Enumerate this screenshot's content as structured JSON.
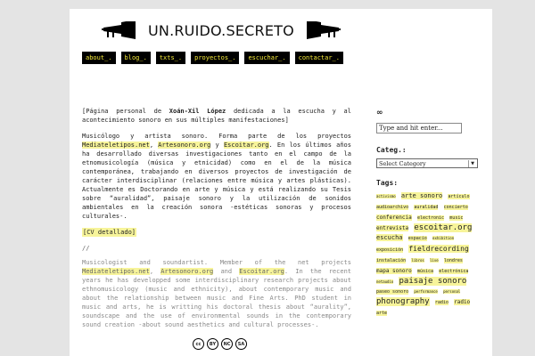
{
  "header": {
    "title": "UN.RUIDO.SECRETO"
  },
  "nav": [
    {
      "label": "about_."
    },
    {
      "label": "blog_."
    },
    {
      "label": "txts_."
    },
    {
      "label": "proyectos_."
    },
    {
      "label": "escuchar_."
    },
    {
      "label": "contactar_."
    }
  ],
  "main": {
    "intro_a": "[Página personal de ",
    "intro_name": "Xoán-Xil López",
    "intro_b": " dedicada a la escucha y al acontecimiento sonoro en sus múltiples manifestaciones]",
    "es_a": "Musicólogo y artista sonoro. Forma parte de los proyectos ",
    "link1": "Mediateletipos.net",
    "sep_comma": ", ",
    "link2": "Artesonoro.org",
    "es_y": " y ",
    "link3": "Escoitar.org",
    "es_b": ". En los últimos años ha desarrollado diversas investigaciones tanto en el campo de la etnomusicología (música y etnicidad) como en el de la música contemporánea, trabajando en diversos proyectos de investigación de carácter interdisciplinar (relaciones entre música y artes plásticas). Actualmente es Doctorando en arte y música y está realizando su Tesis sobre “auralidad”, paisaje sonoro y la utilización de sonidos ambientales en la creación sonora -estéticas sonoras y procesos culturales-.",
    "cv": "[CV detallado]",
    "divider": "//",
    "en_a": "Musicologist and soundartist. Member of the net projects ",
    "en_and": " and ",
    "en_b": ". In the recent years he has developped some interdisciplinary research projects about ethnomusicology (music and ethnicity), about contemporary music and about the relationship between music and Fine Arts. PhD student in music and arts, he is writting his doctoral thesis about “aurality”, soundscape and the use of environmental sounds in the contemporary sound creation -about sound aesthetics and cultural processes-.",
    "cc_badges": [
      "cc",
      "BY",
      "NC",
      "SA"
    ]
  },
  "sidebar": {
    "symbol": "∞",
    "search_value": "Type and hit enter...",
    "categories_title": "Categ.:",
    "categories_select": "Select Category",
    "tags_title": "Tags:",
    "tags": [
      {
        "label": "activismo",
        "size": 4
      },
      {
        "label": "arte sonoro",
        "size": 7
      },
      {
        "label": "artículo",
        "size": 5
      },
      {
        "label": "audioarchivo",
        "size": 5
      },
      {
        "label": "auralidad",
        "size": 5
      },
      {
        "label": "concierto",
        "size": 5
      },
      {
        "label": "conferencia",
        "size": 6
      },
      {
        "label": "electronic",
        "size": 5
      },
      {
        "label": "music",
        "size": 5
      },
      {
        "label": "entrevista",
        "size": 6
      },
      {
        "label": "escoitar.org",
        "size": 9
      },
      {
        "label": "escucha",
        "size": 7
      },
      {
        "label": "espacio",
        "size": 5
      },
      {
        "label": "exhibition",
        "size": 4
      },
      {
        "label": "exposición",
        "size": 5
      },
      {
        "label": "fieldrecording",
        "size": 8
      },
      {
        "label": "instalación",
        "size": 5
      },
      {
        "label": "libros",
        "size": 4
      },
      {
        "label": "live",
        "size": 4
      },
      {
        "label": "londres",
        "size": 5
      },
      {
        "label": "mapa sonoro",
        "size": 6
      },
      {
        "label": "música",
        "size": 5
      },
      {
        "label": "electrónica",
        "size": 5
      },
      {
        "label": "netaudio",
        "size": 4
      },
      {
        "label": "paisaje sonoro",
        "size": 9
      },
      {
        "label": "paseo sonoro",
        "size": 5
      },
      {
        "label": "performance",
        "size": 4
      },
      {
        "label": "personal",
        "size": 4
      },
      {
        "label": "phonography",
        "size": 9
      },
      {
        "label": "radio",
        "size": 5
      },
      {
        "label": "radio",
        "size": 6
      },
      {
        "label": "arte",
        "size": 5
      }
    ]
  },
  "colors": {
    "nav_bg": "#000000",
    "nav_text": "#f5ea3a",
    "highlight": "#f7f49a"
  }
}
